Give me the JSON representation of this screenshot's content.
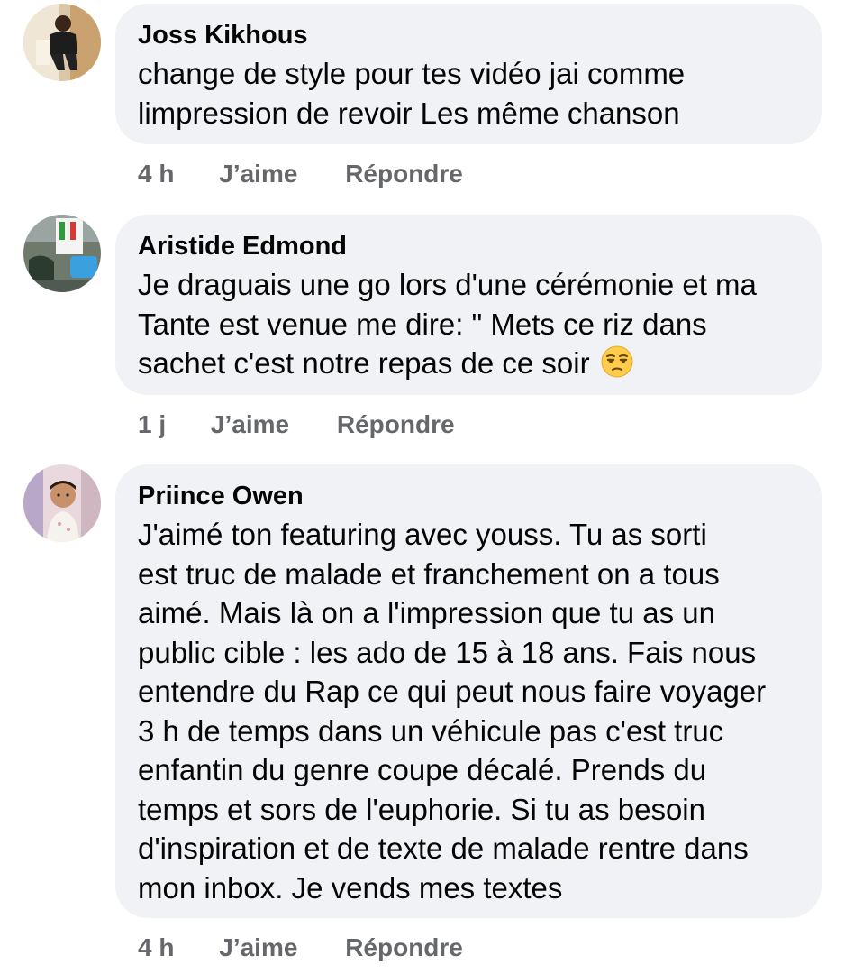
{
  "comments": [
    {
      "author": "Joss Kikhous",
      "text": "change de style pour tes vidéo jai comme\nlimpression de revoir Les même chanson",
      "time": "4 h",
      "like_label": "J’aime",
      "reply_label": "Répondre"
    },
    {
      "author": "Aristide Edmond",
      "text": "Je draguais une go lors d'une cérémonie et ma\nTante est venue me dire: \" Mets ce riz dans\nsachet c'est notre repas de ce soir",
      "emoji": "unamused-face-emoji",
      "time": "1 j",
      "like_label": "J’aime",
      "reply_label": "Répondre"
    },
    {
      "author": "Priince Owen",
      "text": "J'aimé ton featuring avec youss.  Tu as sorti\nest truc de malade et franchement on a tous\naimé.  Mais là on a l'impression que tu as un\npublic cible : les ado de 15 à 18 ans. Fais nous\nentendre du Rap ce qui peut nous faire voyager\n3 h de temps dans un véhicule pas c'est truc\nenfantin du genre coupe décalé.  Prends du\ntemps et sors de l'euphorie.  Si tu as besoin\nd'inspiration et de texte de malade rentre dans\nmon inbox. Je vends mes textes",
      "time": "4 h",
      "like_label": "J’aime",
      "reply_label": "Répondre"
    }
  ],
  "colors": {
    "bubble_bg": "#f0f2f5",
    "text": "#050505",
    "secondary": "#65676b"
  }
}
